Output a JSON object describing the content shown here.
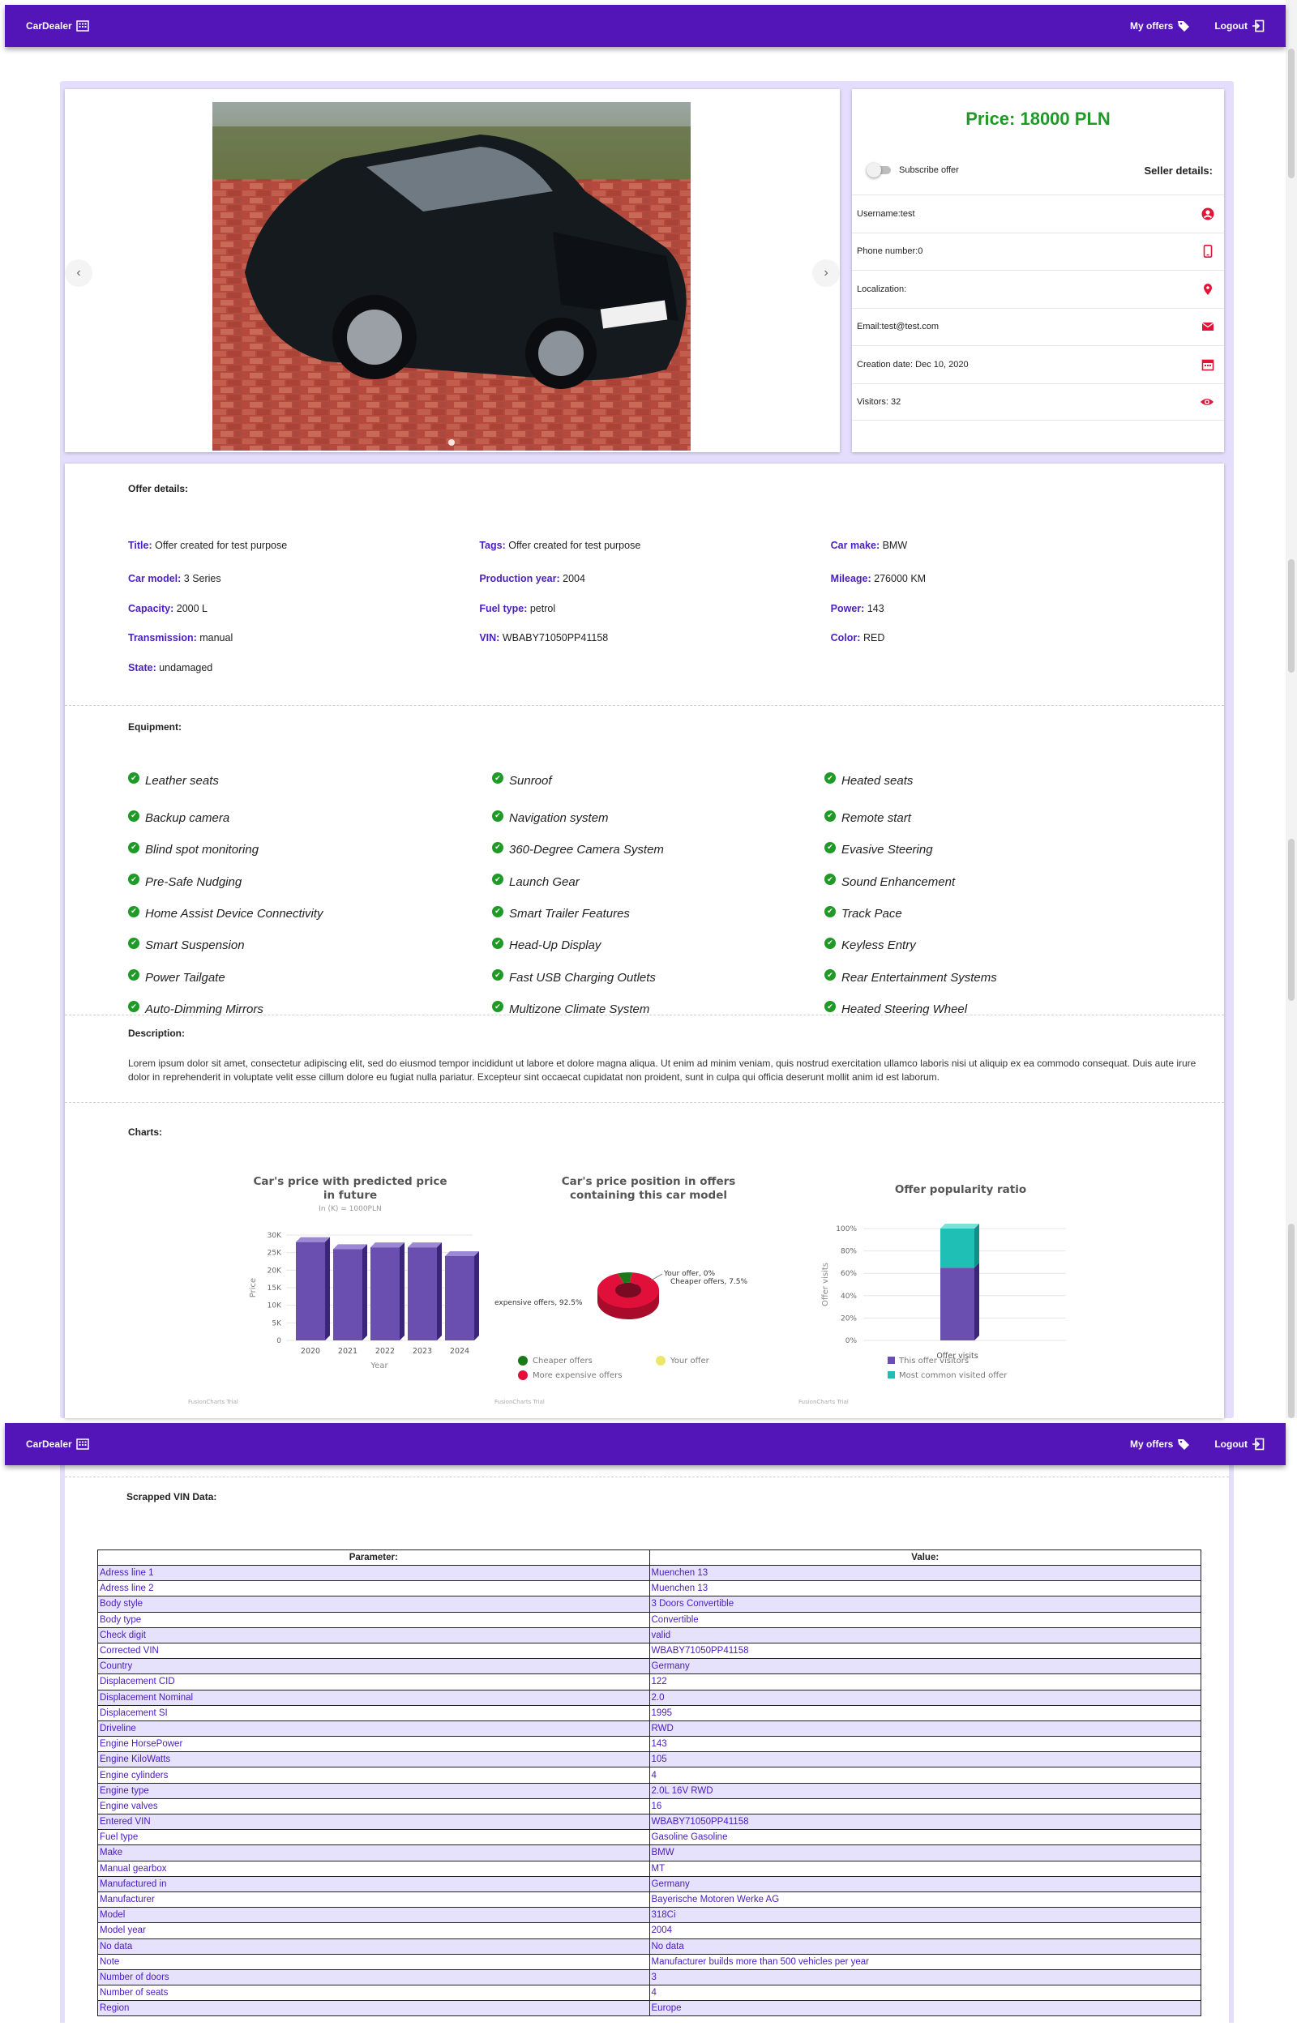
{
  "nav": {
    "brand": "CarDealer",
    "my_offers": "My offers",
    "logout": "Logout"
  },
  "offer": {
    "price": "Price: 18000 PLN",
    "subscribe_label": "Subscribe offer",
    "seller_title": "Seller details:",
    "seller": [
      {
        "text": "Username:test",
        "icon": "user-circle-icon"
      },
      {
        "text": "Phone number:0",
        "icon": "phone-icon"
      },
      {
        "text": "Localization:",
        "icon": "map-pin-icon"
      },
      {
        "text": "Email:test@test.com",
        "icon": "mail-icon"
      },
      {
        "text": "Creation date: Dec 10, 2020",
        "icon": "calendar-icon"
      },
      {
        "text": "Visitors: 32",
        "icon": "eye-icon"
      }
    ]
  },
  "details": {
    "title": "Offer details:",
    "rows": [
      [
        {
          "k": "Title:",
          "v": "Offer created for test purpose"
        },
        {
          "k": "Tags:",
          "v": "Offer created for test purpose"
        },
        {
          "k": "Car make:",
          "v": "BMW"
        }
      ],
      [
        {
          "k": "Car model:",
          "v": "3 Series"
        },
        {
          "k": "Production year:",
          "v": "2004"
        },
        {
          "k": "Mileage:",
          "v": "276000 KM"
        }
      ],
      [
        {
          "k": "Capacity:",
          "v": "2000 L"
        },
        {
          "k": "Fuel type:",
          "v": "petrol"
        },
        {
          "k": "Power:",
          "v": "143"
        }
      ],
      [
        {
          "k": "Transmission:",
          "v": "manual"
        },
        {
          "k": "VIN:",
          "v": "WBABY71050PP41158"
        },
        {
          "k": "Color:",
          "v": "RED"
        }
      ],
      [
        {
          "k": "State:",
          "v": "undamaged"
        }
      ]
    ]
  },
  "equipment": {
    "title": "Equipment:",
    "items": [
      "Leather seats",
      "Sunroof",
      "Heated seats",
      "Backup camera",
      "Navigation system",
      "Remote start",
      "Blind spot monitoring",
      "360-Degree Camera System",
      "Evasive Steering",
      "Pre-Safe Nudging",
      "Launch Gear",
      "Sound Enhancement",
      "Home Assist Device Connectivity",
      "Smart Trailer Features",
      "Track Pace",
      "Smart Suspension",
      "Head-Up Display",
      "Keyless Entry",
      "Power Tailgate",
      "Fast USB Charging Outlets",
      "Rear Entertainment Systems",
      "Auto-Dimming Mirrors",
      "Multizone Climate System",
      "Heated Steering Wheel"
    ]
  },
  "description": {
    "title": "Description:",
    "text": "Lorem ipsum dolor sit amet, consectetur adipiscing elit, sed do eiusmod tempor incididunt ut labore et dolore magna aliqua. Ut enim ad minim veniam, quis nostrud exercitation ullamco laboris nisi ut aliquip ex ea commodo consequat. Duis aute irure dolor in reprehenderit in voluptate velit esse cillum dolore eu fugiat nulla pariatur. Excepteur sint occaecat cupidatat non proident, sunt in culpa qui officia deserunt mollit anim id est laborum."
  },
  "charts_title": "Charts:",
  "chart_data": [
    {
      "type": "bar",
      "title": "Car's price with predicted price in future",
      "subtitle": "In (K) = 1000PLN",
      "xlabel": "Year",
      "ylabel": "Price",
      "categories": [
        "2020",
        "2021",
        "2022",
        "2023",
        "2024"
      ],
      "values": [
        28,
        26,
        26.5,
        26.5,
        24
      ],
      "yticks": [
        "0",
        "5K",
        "10K",
        "15K",
        "20K",
        "25K",
        "30K"
      ],
      "ylim": [
        0,
        30
      ],
      "color": "#6a4fb0",
      "watermark": "FusionCharts Trial"
    },
    {
      "type": "pie",
      "title": "Car's price position in offers containing this car model",
      "slices": [
        {
          "name": "Cheaper offers",
          "value": 7.5,
          "label": "Cheaper offers, 7.5%",
          "color": "#1a7a1a"
        },
        {
          "name": "More expensive offers",
          "value": 92.5,
          "label": "expensive offers, 92.5%",
          "color": "#e0103a"
        },
        {
          "name": "Your offer",
          "value": 0,
          "label": "Your offer, 0%",
          "color": "#e8e86a"
        }
      ],
      "legend": [
        "Cheaper offers",
        "Your offer",
        "More expensive offers"
      ],
      "watermark": "FusionCharts Trial"
    },
    {
      "type": "bar",
      "stacked": true,
      "title": "Offer popularity ratio",
      "ylabel": "Offer visits",
      "categories": [
        "Offer visits"
      ],
      "yticks": [
        "0%",
        "20%",
        "40%",
        "60%",
        "80%",
        "100%"
      ],
      "series": [
        {
          "name": "This offer visitors",
          "values": [
            65
          ],
          "color": "#6a4fb0"
        },
        {
          "name": "Most common visited offer",
          "values": [
            35
          ],
          "color": "#1fbfb5"
        }
      ],
      "ylim": [
        0,
        100
      ],
      "watermark": "FusionCharts Trial"
    }
  ],
  "vin": {
    "title": "Scrapped VIN Data:",
    "headers": [
      "Parameter:",
      "Value:"
    ],
    "rows": [
      [
        "Adress line 1",
        "Muenchen 13"
      ],
      [
        "Adress line 2",
        "Muenchen 13"
      ],
      [
        "Body style",
        "3 Doors Convertible"
      ],
      [
        "Body type",
        "Convertible"
      ],
      [
        "Check digit",
        "valid"
      ],
      [
        "Corrected VIN",
        "WBABY71050PP41158"
      ],
      [
        "Country",
        "Germany"
      ],
      [
        "Displacement CID",
        "122"
      ],
      [
        "Displacement Nominal",
        "2.0"
      ],
      [
        "Displacement SI",
        "1995"
      ],
      [
        "Driveline",
        "RWD"
      ],
      [
        "Engine HorsePower",
        "143"
      ],
      [
        "Engine KiloWatts",
        "105"
      ],
      [
        "Engine cylinders",
        "4"
      ],
      [
        "Engine type",
        "2.0L 16V RWD"
      ],
      [
        "Engine valves",
        "16"
      ],
      [
        "Entered VIN",
        "WBABY71050PP41158"
      ],
      [
        "Fuel type",
        "Gasoline Gasoline"
      ],
      [
        "Make",
        "BMW"
      ],
      [
        "Manual gearbox",
        "MT"
      ],
      [
        "Manufactured in",
        "Germany"
      ],
      [
        "Manufacturer",
        "Bayerische Motoren Werke AG"
      ],
      [
        "Model",
        "318Ci"
      ],
      [
        "Model year",
        "2004"
      ],
      [
        "No data",
        "No data"
      ],
      [
        "Note",
        "Manufacturer builds more than 500 vehicles per year"
      ],
      [
        "Number of doors",
        "3"
      ],
      [
        "Number of seats",
        "4"
      ],
      [
        "Region",
        "Europe"
      ]
    ]
  }
}
